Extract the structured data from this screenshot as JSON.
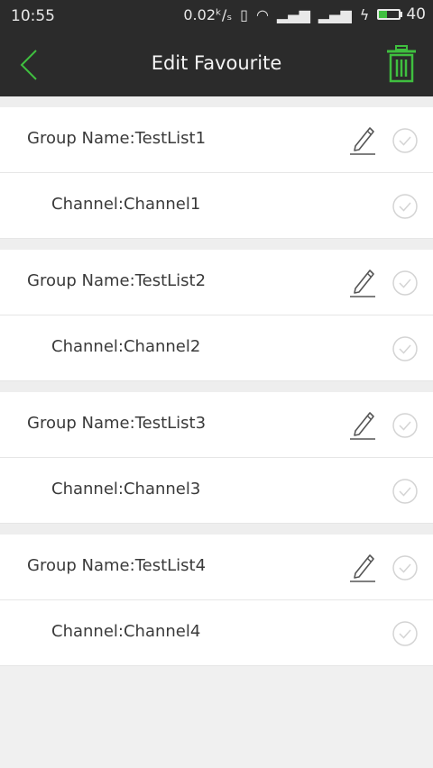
{
  "status_bar": {
    "time": "10:55",
    "net_speed": "0.02",
    "battery": "40",
    "battery_level": 0.4
  },
  "header": {
    "title": "Edit Favourite",
    "accent_color": "#3fbf3f"
  },
  "groups": [
    {
      "group_label": "Group Name:TestList1",
      "channel_label": "Channel:Channel1"
    },
    {
      "group_label": "Group Name:TestList2",
      "channel_label": "Channel:Channel2"
    },
    {
      "group_label": "Group Name:TestList3",
      "channel_label": "Channel:Channel3"
    },
    {
      "group_label": "Group Name:TestList4",
      "channel_label": "Channel:Channel4"
    }
  ],
  "icons": {
    "back": "chevron-left-icon",
    "delete": "trash-icon",
    "edit": "pencil-icon",
    "select": "check-circle-icon"
  }
}
